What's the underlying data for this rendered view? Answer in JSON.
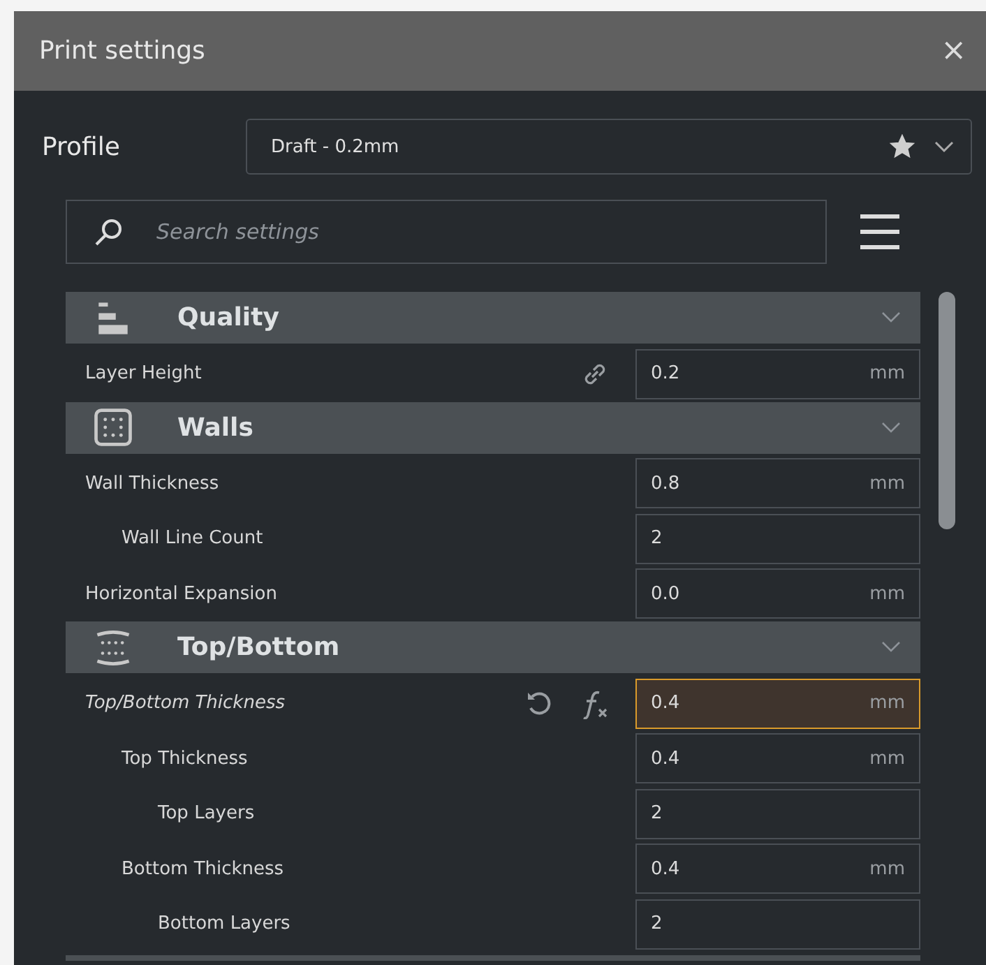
{
  "window": {
    "title": "Print settings",
    "close": "×"
  },
  "profile": {
    "label": "Profile",
    "value": "Draft - 0.2mm",
    "favorite": true
  },
  "search": {
    "placeholder": "Search settings"
  },
  "sections": [
    {
      "kind": "quality",
      "title": "Quality",
      "expanded": true,
      "settings": [
        {
          "label": "Layer Height",
          "value": "0.2",
          "unit": "mm",
          "linked": true,
          "modified": false,
          "formula": false
        }
      ]
    },
    {
      "kind": "walls",
      "title": "Walls",
      "expanded": true,
      "settings": [
        {
          "label": "Wall Thickness",
          "value": "0.8",
          "unit": "mm",
          "linked": false,
          "modified": false,
          "formula": false,
          "children": [
            {
              "label": "Wall Line Count",
              "value": "2",
              "linked": false,
              "modified": false,
              "formula": false
            }
          ]
        },
        {
          "label": "Horizontal Expansion",
          "value": "0.0",
          "unit": "mm",
          "linked": false,
          "modified": false,
          "formula": false
        }
      ]
    },
    {
      "kind": "topbottom",
      "title": "Top/Bottom",
      "expanded": true,
      "settings": [
        {
          "label": "Top/Bottom Thickness",
          "value": "0.4",
          "unit": "mm",
          "linked": false,
          "modified": true,
          "formula": true,
          "children": [
            {
              "label": "Top Thickness",
              "value": "0.4",
              "unit": "mm",
              "linked": false,
              "modified": false,
              "formula": false,
              "children": [
                {
                  "label": "Top Layers",
                  "value": "2",
                  "linked": false,
                  "modified": false,
                  "formula": false
                }
              ]
            },
            {
              "label": "Bottom Thickness",
              "value": "0.4",
              "unit": "mm",
              "linked": false,
              "modified": false,
              "formula": false,
              "children": [
                {
                  "label": "Bottom Layers",
                  "value": "2",
                  "linked": false,
                  "modified": false,
                  "formula": false
                }
              ]
            }
          ]
        }
      ]
    }
  ]
}
